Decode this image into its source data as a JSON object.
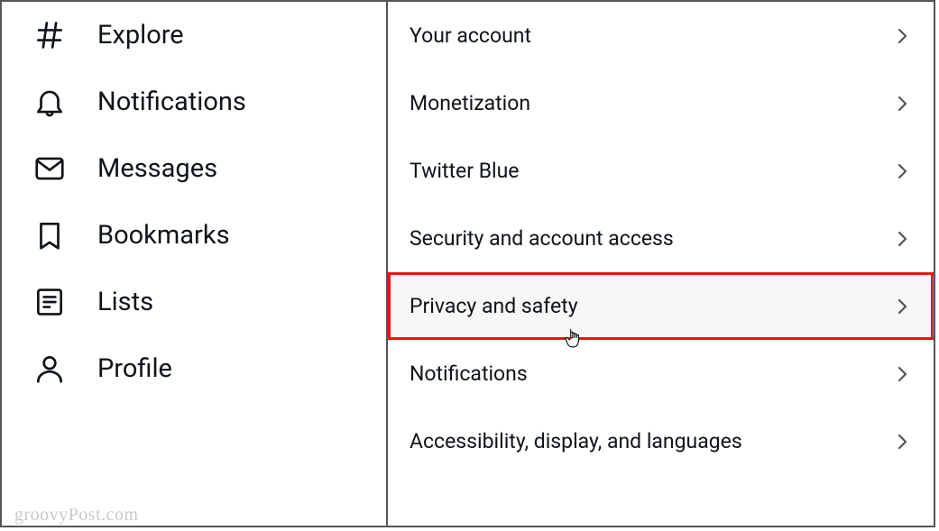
{
  "sidebar": {
    "items": [
      {
        "label": "Explore"
      },
      {
        "label": "Notifications"
      },
      {
        "label": "Messages"
      },
      {
        "label": "Bookmarks"
      },
      {
        "label": "Lists"
      },
      {
        "label": "Profile"
      }
    ]
  },
  "settings": {
    "items": [
      {
        "label": "Your account"
      },
      {
        "label": "Monetization"
      },
      {
        "label": "Twitter Blue"
      },
      {
        "label": "Security and account access"
      },
      {
        "label": "Privacy and safety",
        "highlighted": true
      },
      {
        "label": "Notifications"
      },
      {
        "label": "Accessibility, display, and languages"
      }
    ]
  },
  "watermark": "groovyPost.com"
}
